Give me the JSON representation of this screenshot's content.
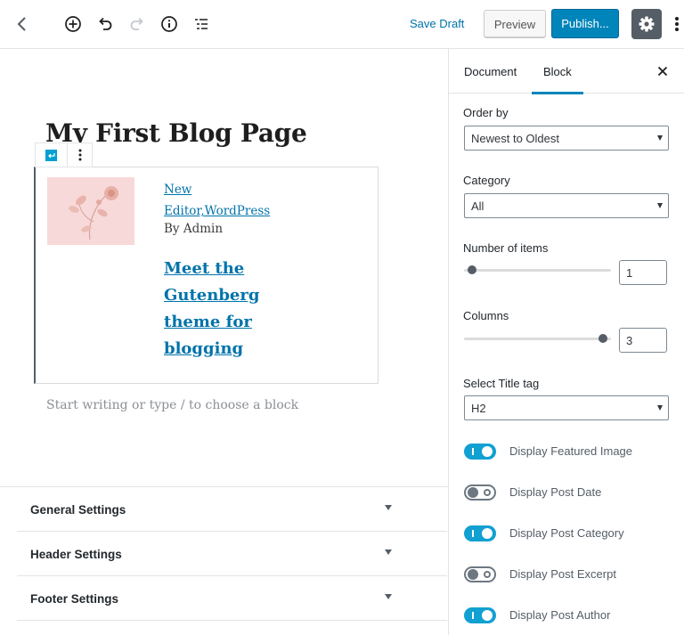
{
  "toolbar": {
    "back_icon": "chevron-left-icon",
    "add_icon": "plus-circle-icon",
    "undo_icon": "undo-icon",
    "redo_icon": "redo-icon",
    "info_icon": "info-icon",
    "outline_icon": "list-outline-icon",
    "save_draft": "Save Draft",
    "preview": "Preview",
    "publish": "Publish...",
    "settings_icon": "gear-icon",
    "more_icon": "more-vertical-icon",
    "accent_color": "#0085ba"
  },
  "editor": {
    "post_title": "My First Blog Page",
    "block": {
      "categories_line1": "New",
      "categories_line2": "Editor,WordPress",
      "author": "By Admin",
      "post_title": "Meet the Gutenberg theme for blogging"
    },
    "appender_placeholder": "Start writing or type / to choose a block",
    "meta_boxes": [
      {
        "label": "General Settings"
      },
      {
        "label": "Header Settings"
      },
      {
        "label": "Footer Settings"
      }
    ]
  },
  "sidebar": {
    "tabs": [
      {
        "label": "Document",
        "active": false
      },
      {
        "label": "Block",
        "active": true
      }
    ],
    "order_by": {
      "label": "Order by",
      "value": "Newest to Oldest"
    },
    "category": {
      "label": "Category",
      "value": "All"
    },
    "number_of_items": {
      "label": "Number of items",
      "value": "1",
      "fraction": 0.0
    },
    "columns": {
      "label": "Columns",
      "value": "3",
      "fraction": 1.0
    },
    "title_tag": {
      "label": "Select Title tag",
      "value": "H2"
    },
    "toggles": [
      {
        "label": "Display Featured Image",
        "on": true
      },
      {
        "label": "Display Post Date",
        "on": false
      },
      {
        "label": "Display Post Category",
        "on": true
      },
      {
        "label": "Display Post Excerpt",
        "on": false
      },
      {
        "label": "Display Post Author",
        "on": true
      }
    ],
    "toggle_on_color": "#11a0d2"
  }
}
